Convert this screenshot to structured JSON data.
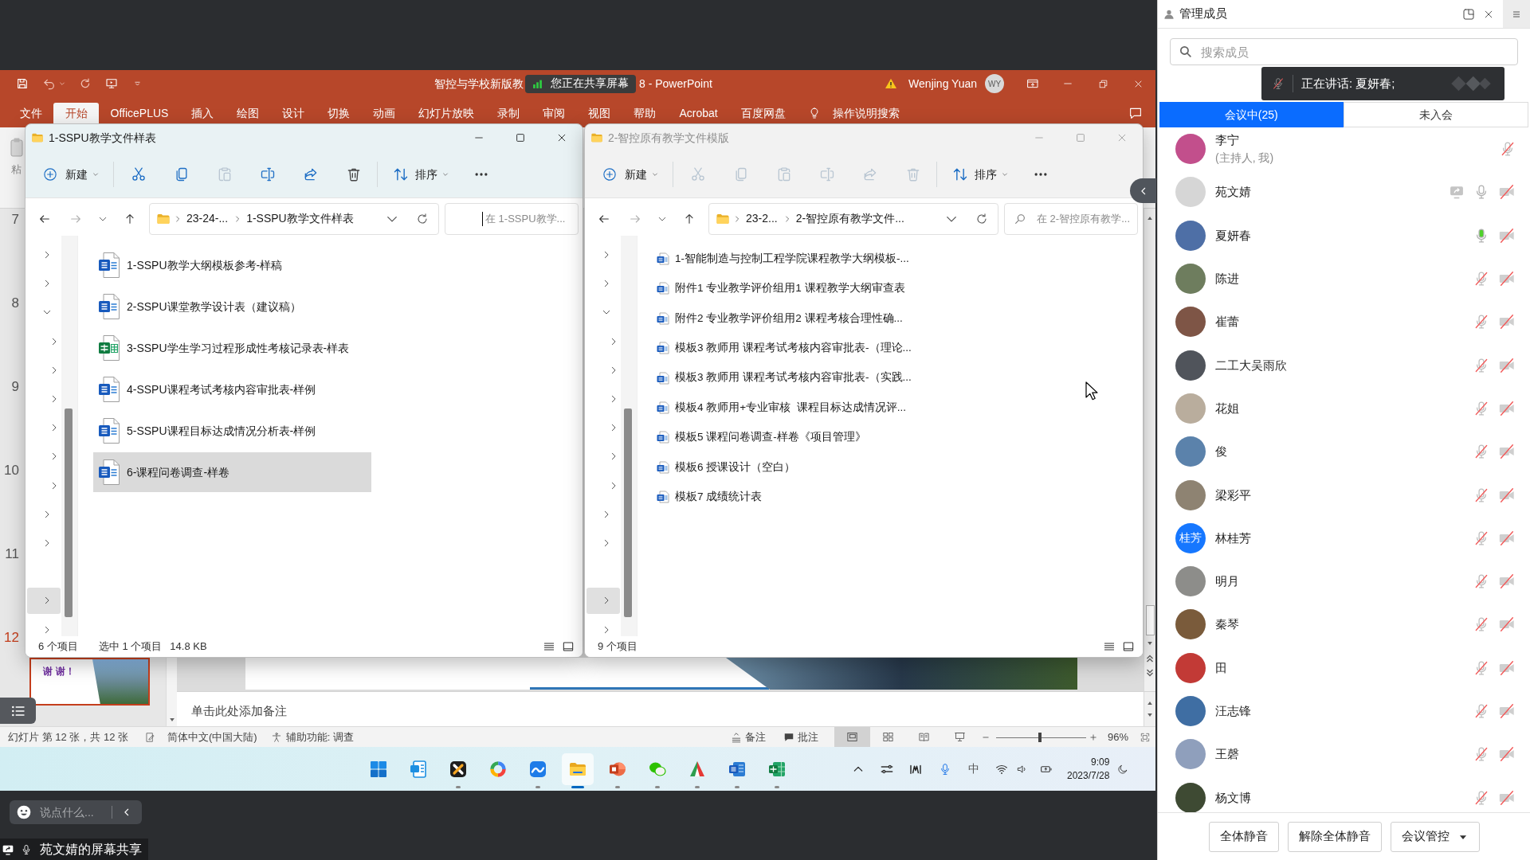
{
  "presentation_window": {
    "title_bar": {
      "title": "智控与学校新版教",
      "share_indicator": "您正在共享屏幕",
      "title_suffix": "8 - PowerPoint",
      "user": "Wenjing Yuan",
      "user_initials": "WY"
    },
    "ribbon_tabs": [
      {
        "label": "文件",
        "selected": false
      },
      {
        "label": "开始",
        "selected": true
      },
      {
        "label": "OfficePLUS",
        "selected": false
      },
      {
        "label": "插入",
        "selected": false
      },
      {
        "label": "绘图",
        "selected": false
      },
      {
        "label": "设计",
        "selected": false
      },
      {
        "label": "切换",
        "selected": false
      },
      {
        "label": "动画",
        "selected": false
      },
      {
        "label": "幻灯片放映",
        "selected": false
      },
      {
        "label": "录制",
        "selected": false
      },
      {
        "label": "审阅",
        "selected": false
      },
      {
        "label": "视图",
        "selected": false
      },
      {
        "label": "帮助",
        "selected": false
      },
      {
        "label": "Acrobat",
        "selected": false
      },
      {
        "label": "百度网盘",
        "selected": false
      }
    ],
    "tell_me": "操作说明搜索",
    "ribbon_fragment": "粘",
    "slides": [
      {
        "number": "7",
        "selected": false
      },
      {
        "number": "8",
        "selected": false
      },
      {
        "number": "9",
        "selected": false
      },
      {
        "number": "10",
        "selected": false
      },
      {
        "number": "11",
        "selected": false
      },
      {
        "number": "12",
        "selected": true,
        "thumbnail_text": "谢 谢！"
      }
    ],
    "notes": {
      "placeholder": "单击此处添加备注"
    },
    "status_bar": {
      "slide_info": "幻灯片 第 12 张，共 12 张",
      "language": "简体中文(中国大陆)",
      "accessibility": "辅助功能: 调查",
      "notes": "备注",
      "comments": "批注",
      "views": [
        {
          "kind": "normal",
          "selected": true
        },
        {
          "kind": "sorter",
          "selected": false
        },
        {
          "kind": "reading",
          "selected": false
        },
        {
          "kind": "slideshow",
          "selected": false
        }
      ],
      "zoom": {
        "level": 0.49,
        "reading": "96%"
      }
    }
  },
  "explorer_windows": [
    {
      "title": "1-SSPU教学文件样表",
      "active": true,
      "new_label": "新建",
      "sort_label": "排序",
      "commands": [
        {
          "kind": "cut",
          "disabled": false
        },
        {
          "kind": "copy",
          "disabled": false
        },
        {
          "kind": "paste",
          "disabled": true
        },
        {
          "kind": "rename",
          "disabled": false
        },
        {
          "kind": "share",
          "disabled": false
        },
        {
          "kind": "delete",
          "disabled": false
        }
      ],
      "breadcrumbs": [
        "23-24-...",
        "1-SSPU教学文件样表"
      ],
      "search": {
        "placeholder": "在 1-SSPU教学...",
        "focused": true
      },
      "nav_items": [
        {
          "kind": "expandable",
          "expanded": false,
          "selected": false
        },
        {
          "kind": "expandable",
          "expanded": false,
          "selected": false
        },
        {
          "kind": "expandable",
          "expanded": true,
          "selected": false,
          "children": [
            {
              "kind": "expandable",
              "expanded": false,
              "selected": false
            },
            {
              "kind": "expandable",
              "expanded": false,
              "selected": false
            },
            {
              "kind": "expandable",
              "expanded": false,
              "selected": false
            },
            {
              "kind": "expandable",
              "expanded": false,
              "selected": false
            },
            {
              "kind": "expandable",
              "expanded": false,
              "selected": false
            },
            {
              "kind": "expandable",
              "expanded": false,
              "selected": false
            }
          ]
        },
        {
          "kind": "expandable",
          "expanded": false,
          "selected": false
        },
        {
          "kind": "expandable",
          "expanded": false,
          "selected": false
        },
        {
          "kind": "plain",
          "selected": false
        },
        {
          "kind": "expandable",
          "expanded": false,
          "selected": true
        },
        {
          "kind": "expandable",
          "expanded": false,
          "selected": false
        }
      ],
      "file_list": {
        "kind": "large",
        "items": [
          {
            "name": "1-SSPU教学大纲模板参考-样稿",
            "kind": "doc",
            "selected": false
          },
          {
            "name": "2-SSPU课堂教学设计表（建议稿）",
            "kind": "doc",
            "selected": false
          },
          {
            "name": "3-SSPU学生学习过程形成性考核记录表-样表",
            "kind": "sheet",
            "selected": false
          },
          {
            "name": "4-SSPU课程考试考核内容审批表-样例",
            "kind": "doc",
            "selected": false
          },
          {
            "name": "5-SSPU课程目标达成情况分析表-样例",
            "kind": "doc",
            "selected": false
          },
          {
            "name": "6-课程问卷调查-样卷",
            "kind": "doc",
            "selected": true
          }
        ]
      },
      "status": [
        "6 个项目",
        "选中 1 个项目",
        "14.8 KB"
      ]
    },
    {
      "title": "2-智控原有教学文件模版",
      "active": false,
      "new_label": "新建",
      "sort_label": "排序",
      "commands": [
        {
          "kind": "cut",
          "disabled": true
        },
        {
          "kind": "copy",
          "disabled": true
        },
        {
          "kind": "paste",
          "disabled": true
        },
        {
          "kind": "rename",
          "disabled": true
        },
        {
          "kind": "share",
          "disabled": true
        },
        {
          "kind": "delete",
          "disabled": true
        }
      ],
      "breadcrumbs": [
        "23-2...",
        "2-智控原有教学文件..."
      ],
      "search": {
        "placeholder": "在 2-智控原有教学...",
        "focused": false
      },
      "nav_items": [
        {
          "kind": "expandable",
          "expanded": false,
          "selected": false
        },
        {
          "kind": "expandable",
          "expanded": false,
          "selected": false
        },
        {
          "kind": "expandable",
          "expanded": true,
          "selected": false,
          "children": [
            {
              "kind": "expandable",
              "expanded": false,
              "selected": false
            },
            {
              "kind": "expandable",
              "expanded": false,
              "selected": false
            },
            {
              "kind": "expandable",
              "expanded": false,
              "selected": false
            },
            {
              "kind": "expandable",
              "expanded": false,
              "selected": false
            },
            {
              "kind": "expandable",
              "expanded": false,
              "selected": false
            },
            {
              "kind": "expandable",
              "expanded": false,
              "selected": false
            }
          ]
        },
        {
          "kind": "expandable",
          "expanded": false,
          "selected": false
        },
        {
          "kind": "expandable",
          "expanded": false,
          "selected": false
        },
        {
          "kind": "plain",
          "selected": false
        },
        {
          "kind": "expandable",
          "expanded": false,
          "selected": true
        },
        {
          "kind": "expandable",
          "expanded": false,
          "selected": false
        }
      ],
      "file_list": {
        "kind": "list",
        "items": [
          {
            "name": "1-智能制造与控制工程学院课程教学大纲模板-...",
            "kind": "doc",
            "selected": false
          },
          {
            "name": "附件1 专业教学评价组用1 课程教学大纲审查表",
            "kind": "doc",
            "selected": false
          },
          {
            "name": "附件2 专业教学评价组用2 课程考核合理性确...",
            "kind": "doc",
            "selected": false
          },
          {
            "name": "模板3 教师用 课程考试考核内容审批表-（理论...",
            "kind": "doc",
            "selected": false
          },
          {
            "name": "模板3 教师用 课程考试考核内容审批表-（实践...",
            "kind": "doc",
            "selected": false
          },
          {
            "name": "模板4 教师用+专业审核  课程目标达成情况评...",
            "kind": "doc",
            "selected": false
          },
          {
            "name": "模板5 课程问卷调查-样卷《项目管理》",
            "kind": "doc",
            "selected": false
          },
          {
            "name": "模板6 授课设计（空白）",
            "kind": "doc",
            "selected": false
          },
          {
            "name": "模板7 成绩统计表",
            "kind": "doc",
            "selected": false
          }
        ]
      },
      "status": [
        "9 个项目"
      ]
    }
  ],
  "taskbar": {
    "apps": [
      {
        "kind": "start",
        "running": false,
        "selected": false
      },
      {
        "kind": "notebook",
        "running": false,
        "selected": false
      },
      {
        "kind": "xtile",
        "running": true,
        "selected": false
      },
      {
        "kind": "ring",
        "running": false,
        "selected": false
      },
      {
        "kind": "wave",
        "running": true,
        "selected": false
      },
      {
        "kind": "folder",
        "running": true,
        "selected": true
      },
      {
        "kind": "slides",
        "running": true,
        "selected": false
      },
      {
        "kind": "chat",
        "running": true,
        "selected": false
      },
      {
        "kind": "tent",
        "running": true,
        "selected": false
      },
      {
        "kind": "doc",
        "running": true,
        "selected": false
      },
      {
        "kind": "sheet",
        "running": true,
        "selected": false
      }
    ],
    "tray": {
      "ime": "中",
      "time": "9:09",
      "date": "2023/7/28"
    }
  },
  "meeting_overlays": {
    "chat": {
      "placeholder": "说点什么..."
    },
    "sharer": "苑文婧的屏幕共享"
  },
  "members_panel": {
    "title": "管理成员",
    "search": {
      "placeholder": "搜索成员"
    },
    "speaking_toast": "正在讲话: 夏妍春;",
    "tabs": [
      {
        "label": "会议中(25)",
        "selected": true
      },
      {
        "label": "未入会",
        "selected": false
      }
    ],
    "members": [
      {
        "name": "李宁",
        "note": "(主持人, 我)",
        "color": "#c24f8c",
        "sharing": false,
        "mic_muted": true,
        "speaking": false
      },
      {
        "name": "苑文婧",
        "color": "#d6d6d6",
        "sharing": true,
        "mic_muted": false,
        "speaking": false,
        "camera_off": true
      },
      {
        "name": "夏妍春",
        "color": "#4e6fa6",
        "sharing": false,
        "mic_muted": false,
        "speaking": true,
        "camera_off": true
      },
      {
        "name": "陈进",
        "color": "#6e7d5e",
        "sharing": false,
        "mic_muted": true,
        "speaking": false,
        "camera_off": true
      },
      {
        "name": "崔蕾",
        "color": "#7e5546",
        "sharing": false,
        "mic_muted": true,
        "speaking": false,
        "camera_off": true
      },
      {
        "name": "二工大吴雨欣",
        "color": "#50545b",
        "sharing": false,
        "mic_muted": true,
        "speaking": false,
        "camera_off": true
      },
      {
        "name": "花姐",
        "color": "#b9ad9d",
        "sharing": false,
        "mic_muted": true,
        "speaking": false,
        "camera_off": true
      },
      {
        "name": "俊",
        "color": "#5b82ab",
        "sharing": false,
        "mic_muted": true,
        "speaking": false,
        "camera_off": true
      },
      {
        "name": "梁彩平",
        "color": "#8e8372",
        "sharing": false,
        "mic_muted": true,
        "speaking": false,
        "camera_off": true
      },
      {
        "name": "林桂芳",
        "avatar_text": "桂芳",
        "color": "#1677ff",
        "sharing": false,
        "mic_muted": true,
        "speaking": false,
        "camera_off": true
      },
      {
        "name": "明月",
        "color": "#8d8d8a",
        "sharing": false,
        "mic_muted": true,
        "speaking": false,
        "camera_off": true
      },
      {
        "name": "秦琴",
        "color": "#7a5b3b",
        "sharing": false,
        "mic_muted": true,
        "speaking": false,
        "camera_off": true
      },
      {
        "name": "田",
        "color": "#c23a36",
        "sharing": false,
        "mic_muted": true,
        "speaking": false,
        "camera_off": true
      },
      {
        "name": "汪志锋",
        "color": "#3f6ea3",
        "sharing": false,
        "mic_muted": true,
        "speaking": false,
        "camera_off": true
      },
      {
        "name": "王磬",
        "color": "#8f9fbc",
        "sharing": false,
        "mic_muted": true,
        "speaking": false,
        "camera_off": true
      },
      {
        "name": "杨文博",
        "color": "#3e4a33",
        "sharing": false,
        "mic_muted": true,
        "speaking": false,
        "camera_off": true
      }
    ],
    "buttons": [
      {
        "label": "全体静音",
        "kind": "mute_all"
      },
      {
        "label": "解除全体静音",
        "kind": "unmute_all"
      },
      {
        "label": "会议管控",
        "kind": "menu"
      }
    ]
  }
}
